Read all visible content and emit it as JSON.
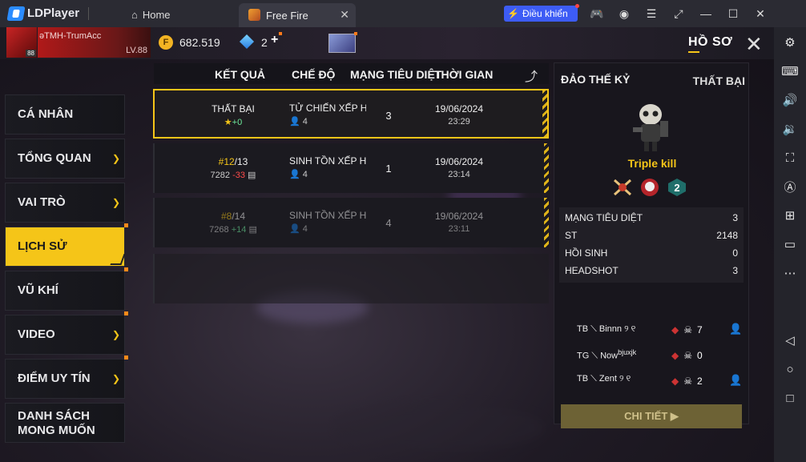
{
  "app": {
    "brand": "LDPlayer",
    "home_tab": "Home",
    "game_tab": "Free Fire",
    "control_label": "Điều khiển"
  },
  "header": {
    "player_name": "əTMH-TrumAcc",
    "level": "LV.88",
    "avatar_level": "88",
    "gold": "682.519",
    "diamonds": "2",
    "profile_title": "HỒ SƠ"
  },
  "menu": {
    "items": [
      {
        "label": "CÁ NHÂN",
        "chevron": false,
        "dot": false
      },
      {
        "label": "TỔNG QUAN",
        "chevron": true,
        "dot": false
      },
      {
        "label": "VAI TRÒ",
        "chevron": true,
        "dot": false
      },
      {
        "label": "LỊCH SỬ",
        "chevron": false,
        "dot": true,
        "active": true
      },
      {
        "label": "VŨ KHÍ",
        "chevron": false,
        "dot": true
      },
      {
        "label": "VIDEO",
        "chevron": true,
        "dot": true
      },
      {
        "label": "ĐIỂM UY TÍN",
        "chevron": true,
        "dot": true
      },
      {
        "label_line1": "DANH SÁCH",
        "label_line2": "MONG MUỐN",
        "chevron": false,
        "dot": false
      }
    ]
  },
  "table": {
    "headers": [
      "KẾT QUẢ",
      "CHẾ ĐỘ",
      "MẠNG TIÊU DIỆT",
      "THỜI GIAN"
    ],
    "rows": [
      {
        "result": "THẤT BẠI",
        "delta": "+0",
        "mode": "TỬ CHIẾN XẾP HẠ",
        "players": "4",
        "kills": "3",
        "date": "19/06/2024",
        "time": "23:29"
      },
      {
        "rank": "#12",
        "of": "/13",
        "score": "7282",
        "delta": "-33",
        "mode": "SINH TỒN XẾP HẠ",
        "players": "4",
        "kills": "1",
        "date": "19/06/2024",
        "time": "23:14"
      },
      {
        "rank": "#8",
        "of": "/14",
        "score": "7268",
        "delta": "+14",
        "mode": "SINH TỒN XẾP HẠ",
        "players": "4",
        "kills": "4",
        "date": "19/06/2024",
        "time": "23:11"
      }
    ]
  },
  "detail": {
    "map": "ĐẢO THẾ KỶ",
    "outcome": "THẤT BẠI",
    "achievement": "Triple kill",
    "stats": [
      {
        "label": "MẠNG TIÊU DIỆT",
        "value": "3"
      },
      {
        "label": "ST",
        "value": "2148"
      },
      {
        "label": "HỒI SINH",
        "value": "0"
      },
      {
        "label": "HEADSHOT",
        "value": "3"
      }
    ],
    "teammates": [
      {
        "tag": "TB",
        "name": "Binnn ୨ ୧",
        "kills": "7"
      },
      {
        "tag": "TG",
        "name": "Now",
        "sup": "bjuxjk",
        "kills": "0"
      },
      {
        "tag": "TB",
        "name": "Zent ୨ ୧",
        "kills": "2"
      }
    ],
    "detail_button": "CHI TIẾT"
  }
}
